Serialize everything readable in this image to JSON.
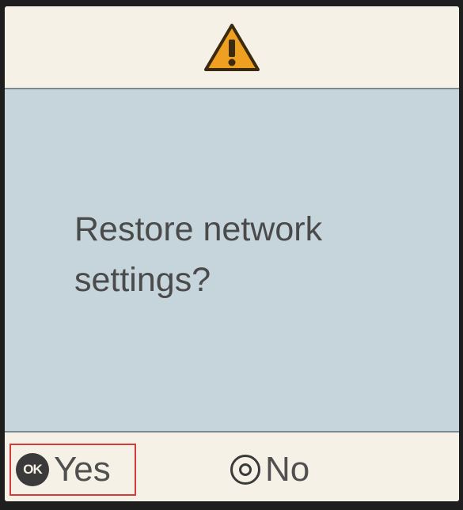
{
  "header": {
    "icon": "warning-icon",
    "icon_color": "#f0a020"
  },
  "dialog": {
    "message_line1": "Restore network",
    "message_line2": "settings?"
  },
  "footer": {
    "yes": {
      "icon": "ok-icon",
      "icon_text": "OK",
      "label": "Yes"
    },
    "no": {
      "icon": "stop-icon",
      "label": "No"
    }
  },
  "colors": {
    "header_bg": "#f6f1e6",
    "body_bg": "#c6d4dc",
    "selection_border": "#d43c3c"
  }
}
